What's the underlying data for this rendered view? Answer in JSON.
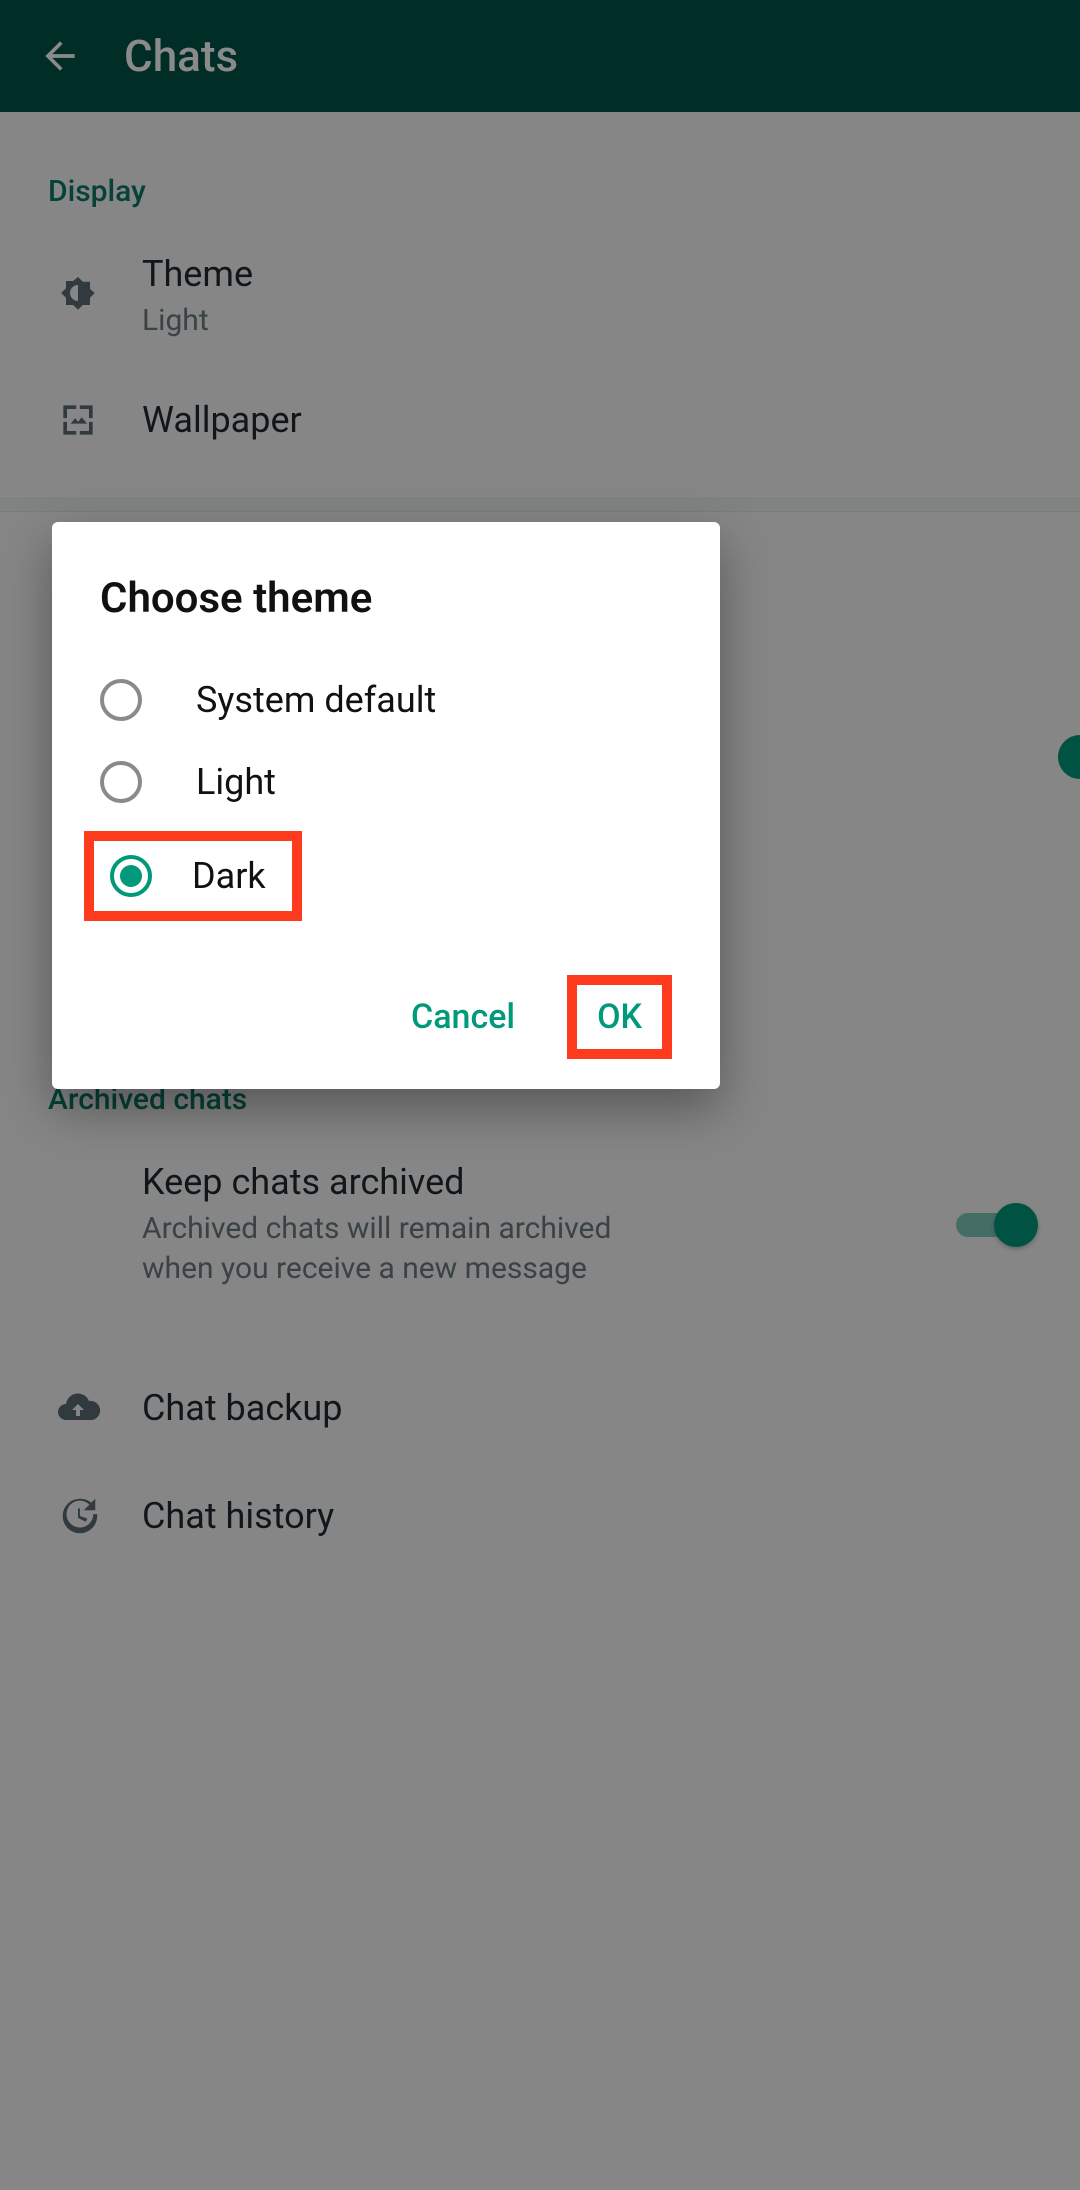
{
  "appbar": {
    "title": "Chats"
  },
  "sections": {
    "display": {
      "label": "Display",
      "theme": {
        "title": "Theme",
        "value": "Light"
      },
      "wallpaper": {
        "title": "Wallpaper"
      }
    },
    "archived": {
      "label": "Archived chats",
      "keep": {
        "title": "Keep chats archived",
        "subtitle": "Archived chats will remain archived when you receive a new message"
      }
    },
    "backup": {
      "title": "Chat backup"
    },
    "history": {
      "title": "Chat history"
    }
  },
  "dialog": {
    "title": "Choose theme",
    "options": {
      "system": "System default",
      "light": "Light",
      "dark": "Dark"
    },
    "selected": "dark",
    "actions": {
      "cancel": "Cancel",
      "ok": "OK"
    }
  }
}
